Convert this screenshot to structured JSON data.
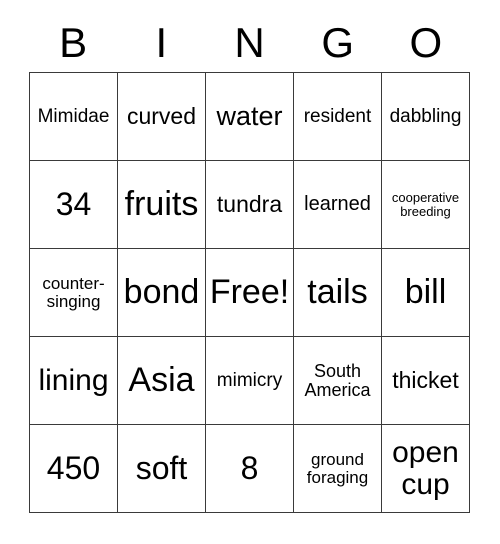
{
  "card": {
    "title": "BINGO",
    "header_letters": [
      "B",
      "I",
      "N",
      "G",
      "O"
    ],
    "free_space": "Free!",
    "colors": {
      "background": "#ffffff",
      "border": "#3a3a3a",
      "text": "#000000"
    },
    "grid": {
      "columns": 5,
      "rows": 5,
      "cells": [
        [
          {
            "text": "Mimidae",
            "size": "m"
          },
          {
            "text": "curved",
            "size": "l"
          },
          {
            "text": "water",
            "size": "xl"
          },
          {
            "text": "resident",
            "size": "m"
          },
          {
            "text": "dabbling",
            "size": "m"
          }
        ],
        [
          {
            "text": "34",
            "size": "3xl"
          },
          {
            "text": "fruits",
            "size": "4xl"
          },
          {
            "text": "tundra",
            "size": "l"
          },
          {
            "text": "learned",
            "size": "m2"
          },
          {
            "text": "cooperative breeding",
            "size": "xs"
          }
        ],
        [
          {
            "text": "counter-singing",
            "size": "s"
          },
          {
            "text": "bond",
            "size": "4xl"
          },
          {
            "text": "Free!",
            "size": "4xl"
          },
          {
            "text": "tails",
            "size": "4xl"
          },
          {
            "text": "bill",
            "size": "4xl"
          }
        ],
        [
          {
            "text": "lining",
            "size": "xxl"
          },
          {
            "text": "Asia",
            "size": "4xl"
          },
          {
            "text": "mimicry",
            "size": "m"
          },
          {
            "text": "South America",
            "size": "s2"
          },
          {
            "text": "thicket",
            "size": "l"
          }
        ],
        [
          {
            "text": "450",
            "size": "3xl"
          },
          {
            "text": "soft",
            "size": "3xl"
          },
          {
            "text": "8",
            "size": "3xl"
          },
          {
            "text": "ground foraging",
            "size": "s"
          },
          {
            "text": "open cup",
            "size": "xxl"
          }
        ]
      ]
    }
  }
}
